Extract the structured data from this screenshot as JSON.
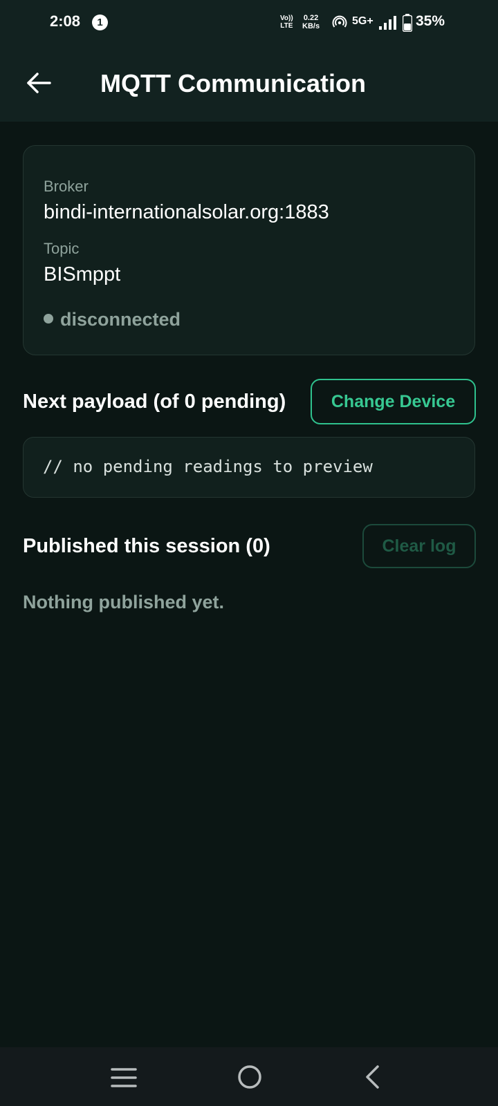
{
  "status_bar": {
    "time": "2:08",
    "notification_count": "1",
    "volte_top": "Vo))",
    "volte_bottom": "LTE",
    "net_speed_value": "0.22",
    "net_speed_unit": "KB/s",
    "network_type": "5G+",
    "battery": "35%"
  },
  "header": {
    "title": "MQTT Communication",
    "back_icon": "arrow-left-icon"
  },
  "connection": {
    "broker_label": "Broker",
    "broker_value": "bindi-internationalsolar.org:1883",
    "topic_label": "Topic",
    "topic_value": "BISmppt",
    "status": "disconnected"
  },
  "payload": {
    "heading": "Next payload (of 0 pending)",
    "change_device_label": "Change Device",
    "preview_text": "// no pending readings to preview"
  },
  "published": {
    "heading": "Published this session (0)",
    "clear_log_label": "Clear log",
    "empty_message": "Nothing published yet."
  },
  "nav_bar": {
    "recent_icon": "menu-lines-icon",
    "home_icon": "circle-home-icon",
    "back_icon": "chevron-left-icon"
  },
  "colors": {
    "background": "#0b1614",
    "header": "#122220",
    "accent": "#2fc28e",
    "muted_text": "#8fa39c"
  }
}
